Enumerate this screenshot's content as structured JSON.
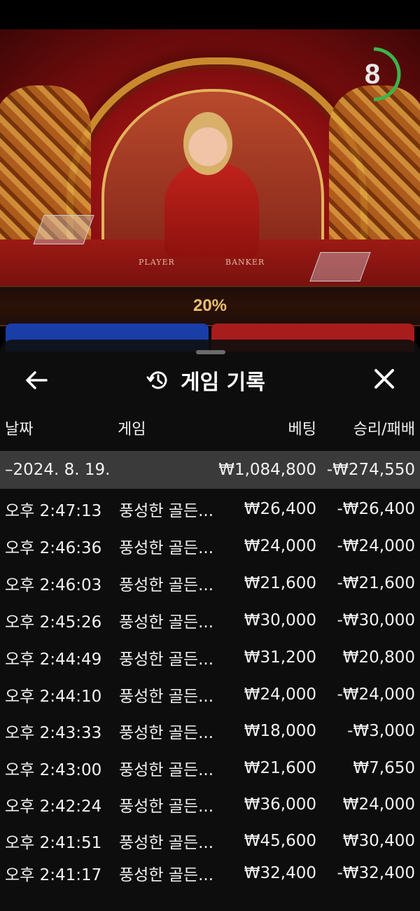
{
  "game_view": {
    "timer": "8",
    "percentage": "20%",
    "table_labels": {
      "player": "PLAYER",
      "banker": "BANKER"
    }
  },
  "history_sheet": {
    "title": "게임 기록",
    "columns": {
      "date": "날짜",
      "game": "게임",
      "bet": "베팅",
      "result": "승리/패배"
    },
    "summary": {
      "date": "–2024. 8. 19.",
      "bet": "₩1,084,800",
      "result": "-₩274,550"
    },
    "rows": [
      {
        "time": "오후 2:47:13",
        "game": "풍성한 골든...",
        "bet": "₩26,400",
        "result": "-₩26,400"
      },
      {
        "time": "오후 2:46:36",
        "game": "풍성한 골든...",
        "bet": "₩24,000",
        "result": "-₩24,000"
      },
      {
        "time": "오후 2:46:03",
        "game": "풍성한 골든...",
        "bet": "₩21,600",
        "result": "-₩21,600"
      },
      {
        "time": "오후 2:45:26",
        "game": "풍성한 골든...",
        "bet": "₩30,000",
        "result": "-₩30,000"
      },
      {
        "time": "오후 2:44:49",
        "game": "풍성한 골든...",
        "bet": "₩31,200",
        "result": "₩20,800"
      },
      {
        "time": "오후 2:44:10",
        "game": "풍성한 골든...",
        "bet": "₩24,000",
        "result": "-₩24,000"
      },
      {
        "time": "오후 2:43:33",
        "game": "풍성한 골든...",
        "bet": "₩18,000",
        "result": "-₩3,000"
      },
      {
        "time": "오후 2:43:00",
        "game": "풍성한 골든...",
        "bet": "₩21,600",
        "result": "₩7,650"
      },
      {
        "time": "오후 2:42:24",
        "game": "풍성한 골든...",
        "bet": "₩36,000",
        "result": "₩24,000"
      },
      {
        "time": "오후 2:41:51",
        "game": "풍성한 골든...",
        "bet": "₩45,600",
        "result": "₩30,400"
      },
      {
        "time": "오후 2:41:17",
        "game": "풍성한 골든...",
        "bet": "₩32,400",
        "result": "-₩32,400"
      }
    ]
  },
  "colors": {
    "accent_gold": "#e8c070",
    "timer_green": "#3bb54a",
    "sheet_bg": "#0e0e0e",
    "summary_bg": "#3a3a3a"
  },
  "icons": {
    "back": "arrow-left-icon",
    "history": "history-clock-icon",
    "close": "close-icon"
  }
}
